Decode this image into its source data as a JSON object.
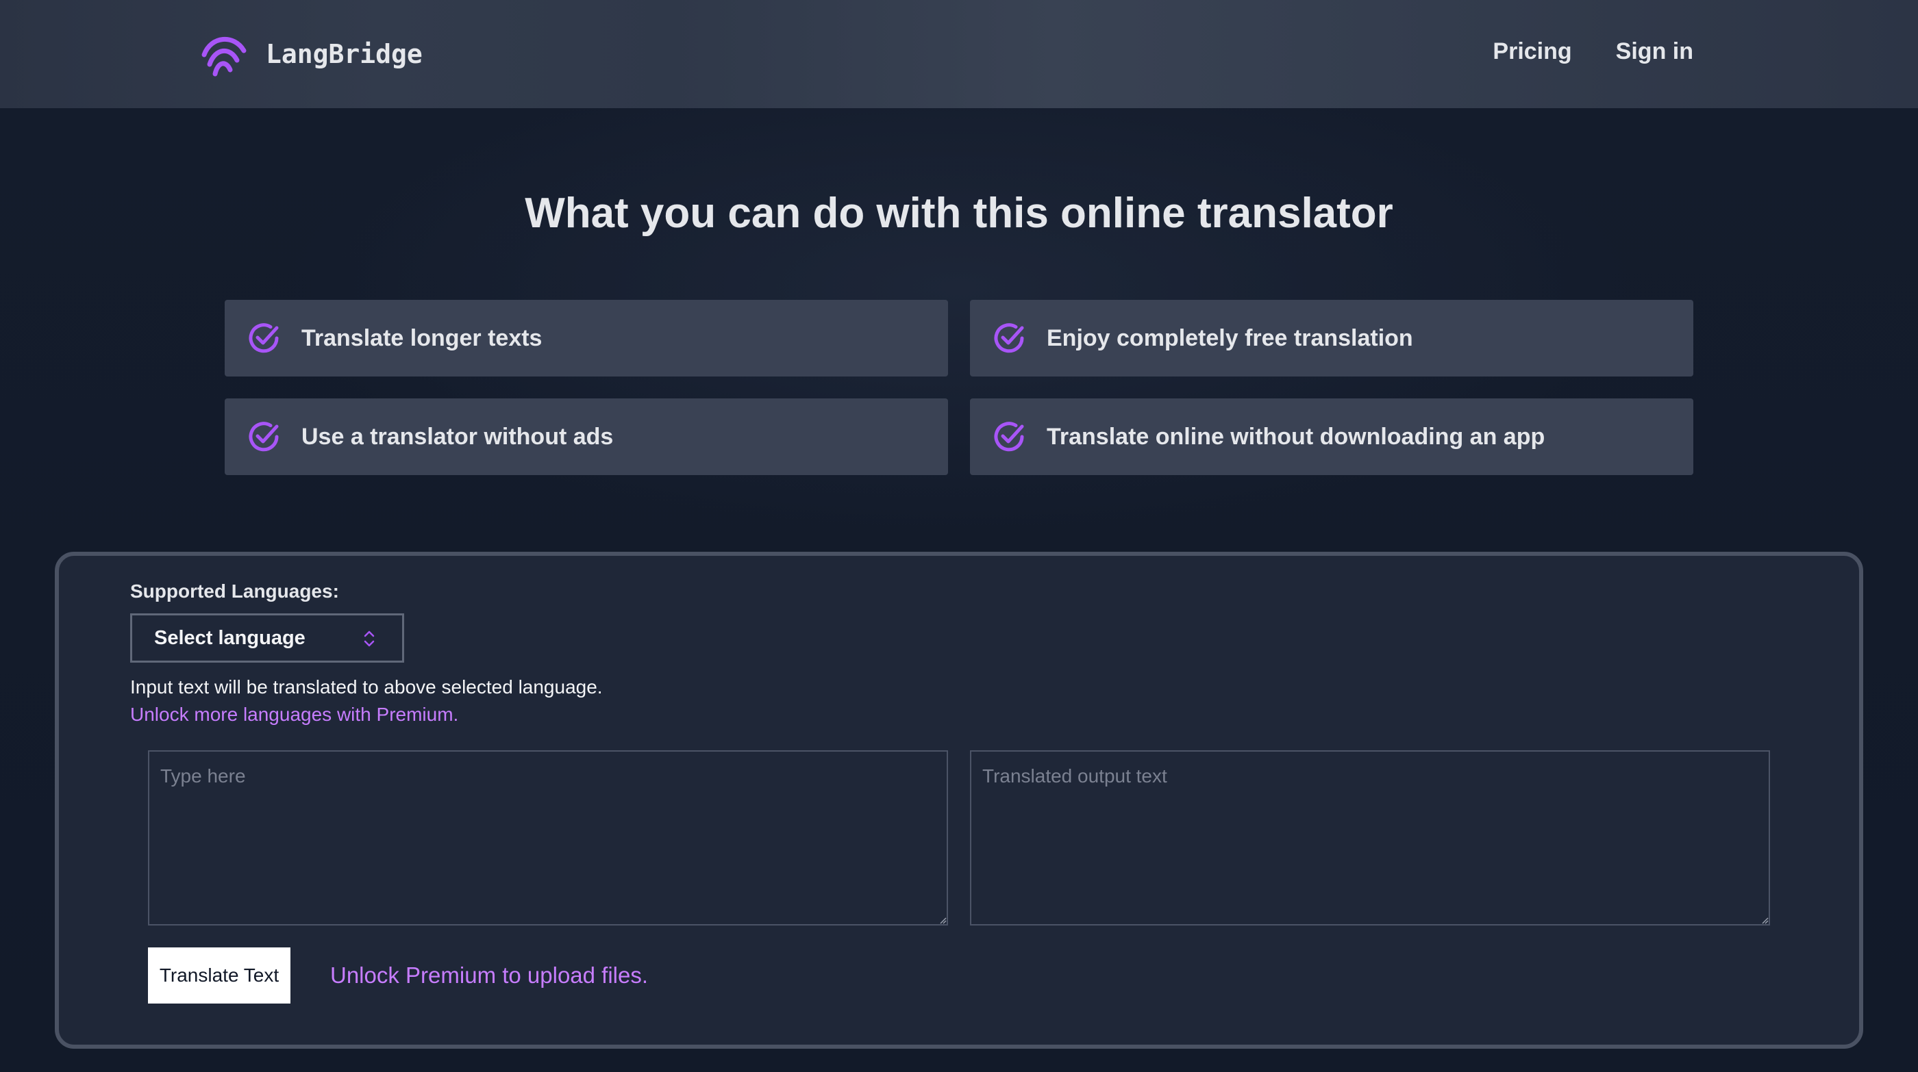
{
  "header": {
    "brand": "LangBridge",
    "logo_icon": "arch-waves-logo",
    "nav": [
      "Pricing",
      "Sign in"
    ]
  },
  "hero": {
    "title": "What you can do with this online translator",
    "features": [
      "Translate longer texts",
      "Enjoy completely free translation",
      "Use a translator without ads",
      "Translate online without downloading an app"
    ],
    "feature_icon": "check-circle-icon"
  },
  "translator": {
    "languages_label": "Supported Languages:",
    "select_value": "Select language",
    "info": "Input text will be translated to above selected language.",
    "premium_languages_link": "Unlock more languages with Premium.",
    "input_placeholder": "Type here",
    "output_placeholder": "Translated output text",
    "translate_button": "Translate Text",
    "upload_link": "Unlock Premium to upload files."
  },
  "colors": {
    "accent": "#a855f7",
    "link": "#c77dff",
    "background": "#131b2b",
    "card": "#3a4254",
    "panel": "#1f2738"
  }
}
